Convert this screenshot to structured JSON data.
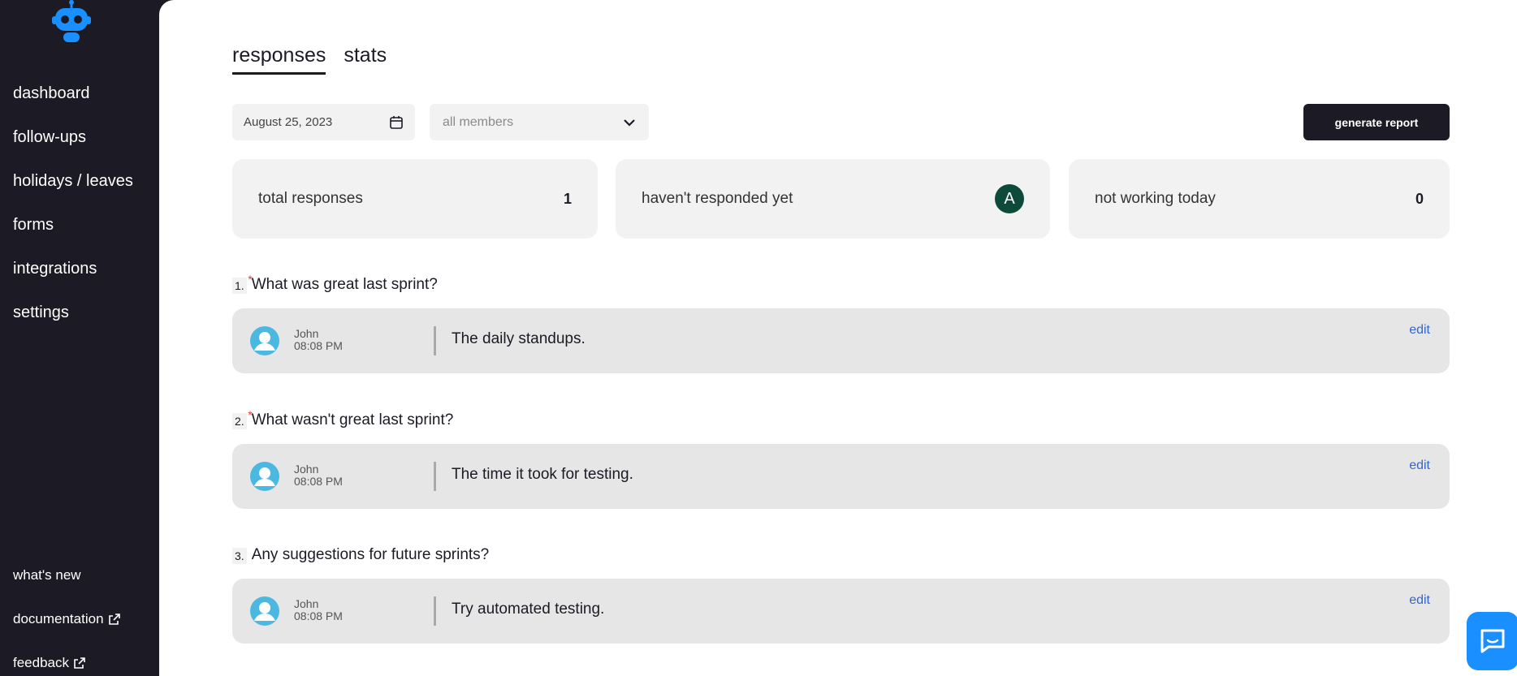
{
  "sidebar": {
    "nav": [
      "dashboard",
      "follow-ups",
      "holidays / leaves",
      "forms",
      "integrations",
      "settings"
    ],
    "bottom": [
      "what's new",
      "documentation",
      "feedback"
    ]
  },
  "tabs": [
    "responses",
    "stats"
  ],
  "filters": {
    "date": "August 25, 2023",
    "members_placeholder": "all members"
  },
  "generate_report_label": "generate report",
  "stats": {
    "total_responses_label": "total responses",
    "total_responses_value": "1",
    "not_responded_label": "haven't responded yet",
    "not_responded_avatar": "A",
    "not_working_label": "not working today",
    "not_working_value": "0"
  },
  "questions": [
    {
      "num": "1.",
      "required": "*",
      "text": "What was great last sprint?",
      "user": "John",
      "time": "08:08 PM",
      "answer": "The daily standups.",
      "edit": "edit"
    },
    {
      "num": "2.",
      "required": "*",
      "text": "What wasn't great last sprint?",
      "user": "John",
      "time": "08:08 PM",
      "answer": "The time it took for testing.",
      "edit": "edit"
    },
    {
      "num": "3.",
      "required": "",
      "text": "Any suggestions for future sprints?",
      "user": "John",
      "time": "08:08 PM",
      "answer": "Try automated testing.",
      "edit": "edit"
    }
  ],
  "colors": {
    "sidebar_bg": "#1c1a24",
    "card_bg": "#f2f2f2",
    "answer_bg": "#e6e6e6",
    "edit_link": "#3366cc",
    "chat_button": "#1a8fff",
    "avatar_green": "#0d4a3a"
  }
}
